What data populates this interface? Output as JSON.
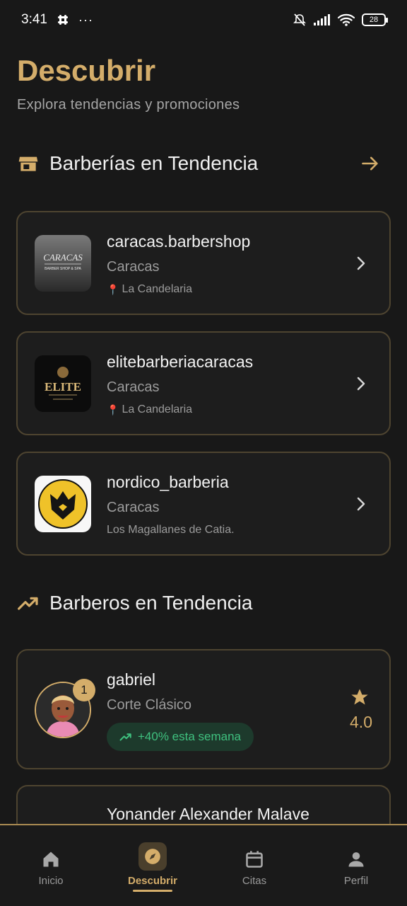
{
  "status_bar": {
    "time": "3:41",
    "dots": "···",
    "battery": "28"
  },
  "header": {
    "title": "Descubrir",
    "subtitle": "Explora tendencias y promociones"
  },
  "sections": {
    "shops_title": "Barberías en Tendencia",
    "barbers_title": "Barberos en Tendencia"
  },
  "shops": [
    {
      "name": "caracas.barbershop",
      "city": "Caracas",
      "pin": "📍",
      "location": "La Candelaria",
      "logo_text": "CARACAS",
      "logo_sub": "BARBER SHOP & SPA"
    },
    {
      "name": "elitebarberiacaracas",
      "city": "Caracas",
      "pin": "📍",
      "location": "La Candelaria",
      "logo_text": "ELITE"
    },
    {
      "name": "nordico_barberia",
      "city": "Caracas",
      "location": "Los Magallanes de Catia."
    }
  ],
  "barbers": [
    {
      "rank": "1",
      "name": "gabriel",
      "specialty": "Corte Clásico",
      "trend": "+40% esta semana",
      "rating": "4.0"
    },
    {
      "name": "Yonander Alexander Malave"
    }
  ],
  "nav": {
    "items": [
      {
        "label": "Inicio",
        "icon": "home-icon"
      },
      {
        "label": "Descubrir",
        "icon": "compass-icon"
      },
      {
        "label": "Citas",
        "icon": "calendar-icon"
      },
      {
        "label": "Perfil",
        "icon": "person-icon"
      }
    ],
    "active": "Descubrir"
  },
  "colors": {
    "accent": "#d4ad6a",
    "background": "#181818",
    "card_border": "#4e4430",
    "trend_green": "#3fc17f"
  }
}
